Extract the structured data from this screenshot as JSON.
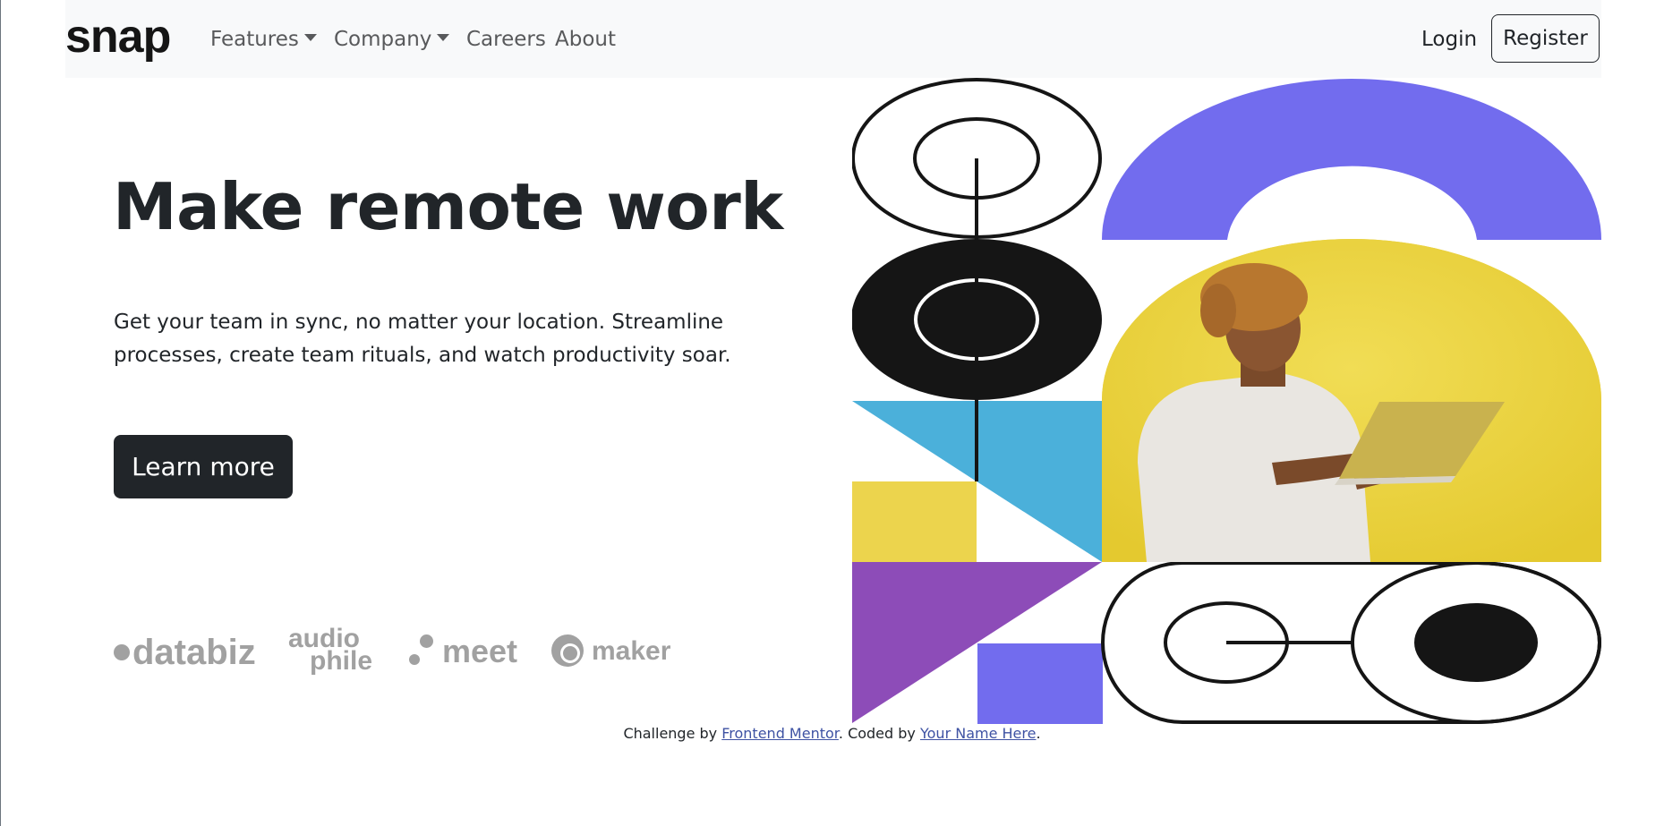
{
  "brand": {
    "logo_text": "snap"
  },
  "nav": {
    "items": [
      {
        "label": "Features",
        "dropdown": true
      },
      {
        "label": "Company",
        "dropdown": true
      },
      {
        "label": "Careers",
        "dropdown": false
      },
      {
        "label": "About",
        "dropdown": false
      }
    ],
    "login_label": "Login",
    "register_label": "Register"
  },
  "hero": {
    "title": "Make remote work",
    "description": "Get your team in sync, no matter your location. Streamline processes, create team rituals, and watch productivity soar.",
    "cta_label": "Learn more"
  },
  "clients": [
    {
      "name": "databiz"
    },
    {
      "name": "audiophile",
      "line1": "audio",
      "line2": "phile"
    },
    {
      "name": "meet"
    },
    {
      "name": "maker"
    }
  ],
  "footer": {
    "prefix": "Challenge by ",
    "link1": "Frontend Mentor",
    "middle": ". Coded by ",
    "link2": "Your Name Here",
    "suffix": "."
  },
  "colors": {
    "accent_purple": "#726cee",
    "accent_blue": "#4bb0da",
    "accent_yellow": "#ecd44d",
    "accent_violet": "#8d4cb8",
    "dark": "#212529"
  }
}
